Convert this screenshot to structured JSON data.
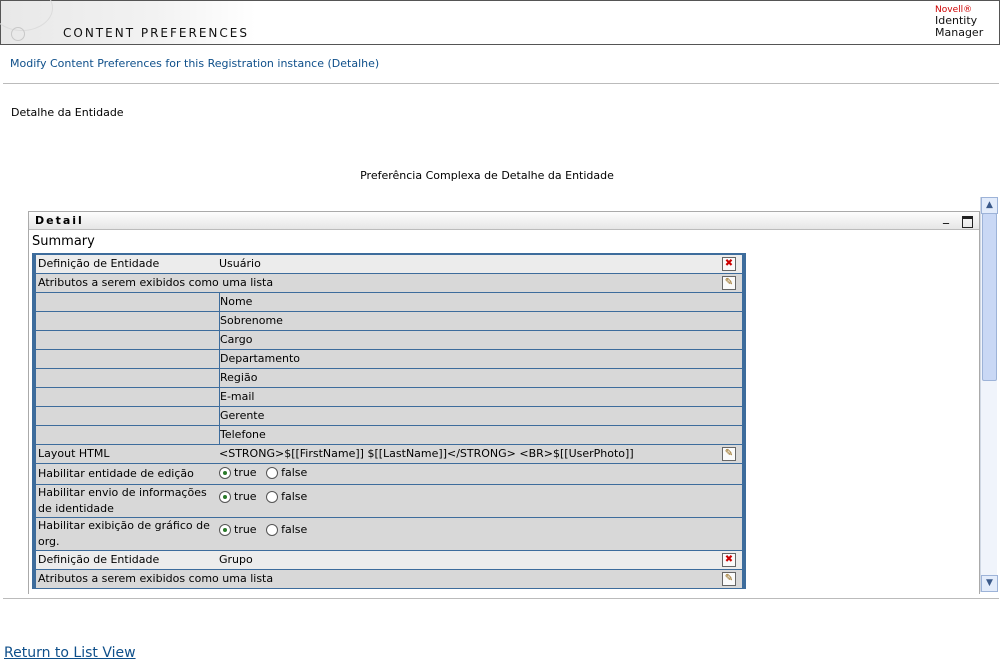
{
  "header": {
    "title": "CONTENT PREFERENCES",
    "brand_novell": "Novell®",
    "brand_line1": "Identity",
    "brand_line2": "Manager"
  },
  "subtitle": "Modify Content Preferences for this Registration instance (Detalhe)",
  "entity_label": "Detalhe da Entidade",
  "center_title": "Preferência Complexa de Detalhe da Entidade",
  "portlet": {
    "title": "Detail",
    "summary": "Summary",
    "minimize_glyph": "_"
  },
  "rows": [
    {
      "label": "Definição de Entidade",
      "value": "Usuário",
      "action": "delete"
    },
    {
      "label": "Atributos a serem exibidos como uma lista",
      "value": "",
      "action": "edit"
    }
  ],
  "attributes": [
    "Nome",
    "Sobrenome",
    "Cargo",
    "Departamento",
    "Região",
    "E-mail",
    "Gerente",
    "Telefone"
  ],
  "layout_html": {
    "label": "Layout HTML",
    "value": "<STRONG>$[[FirstName]] $[[LastName]]</STRONG> <BR>$[[UserPhoto]]"
  },
  "toggles": [
    {
      "label": "Habilitar entidade de edição",
      "true_label": "true",
      "false_label": "false",
      "selected": "true"
    },
    {
      "label": "Habilitar envio de informações de identidade",
      "true_label": "true",
      "false_label": "false",
      "selected": "true"
    },
    {
      "label": "Habilitar exibição de gráfico de org.",
      "true_label": "true",
      "false_label": "false",
      "selected": "true"
    }
  ],
  "rows2": [
    {
      "label": "Definição de Entidade",
      "value": "Grupo",
      "action": "delete"
    },
    {
      "label": "Atributos a serem exibidos como uma lista",
      "value": "",
      "action": "edit"
    }
  ],
  "icons": {
    "delete": "✖",
    "edit": "✎",
    "scroll_up": "▲",
    "scroll_down": "▼"
  },
  "return_link": "Return to List View"
}
